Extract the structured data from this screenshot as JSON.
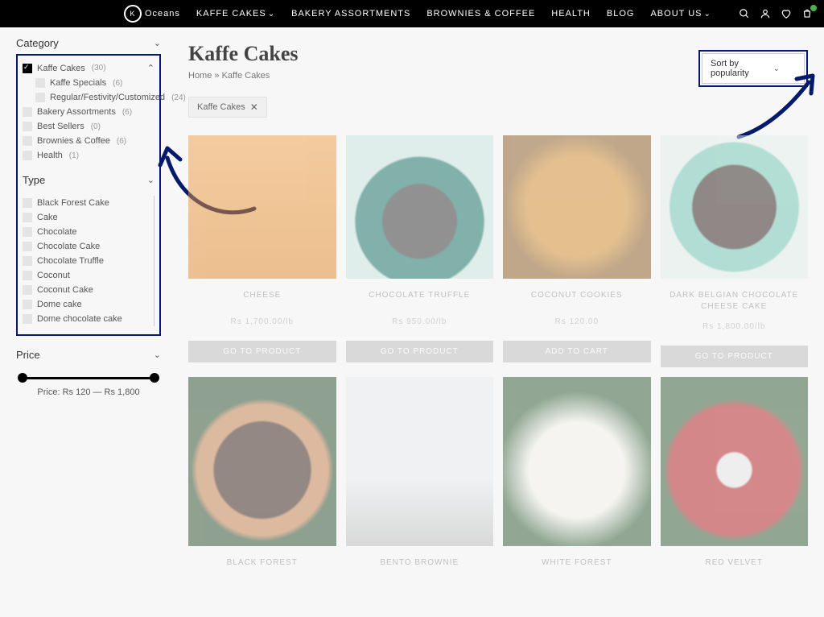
{
  "nav": {
    "brand": "Oceans",
    "items": [
      "KAFFE CAKES",
      "BAKERY ASSORTMENTS",
      "BROWNIES & COFFEE",
      "HEALTH",
      "BLOG",
      "ABOUT US"
    ]
  },
  "sidebar": {
    "category_heading": "Category",
    "type_heading": "Type",
    "price_heading": "Price",
    "categories": [
      {
        "label": "Kaffe Cakes",
        "count": "(30)",
        "checked": true
      },
      {
        "label": "Kaffe Specials",
        "count": "(6)",
        "checked": false,
        "indent": true
      },
      {
        "label": "Regular/Festivity/Customized",
        "count": "(24)",
        "checked": false,
        "indent": true
      },
      {
        "label": "Bakery Assortments",
        "count": "(6)",
        "checked": false
      },
      {
        "label": "Best Sellers",
        "count": "(0)",
        "checked": false
      },
      {
        "label": "Brownies & Coffee",
        "count": "(6)",
        "checked": false
      },
      {
        "label": "Health",
        "count": "(1)",
        "checked": false
      }
    ],
    "types": [
      "Black Forest Cake",
      "Cake",
      "Chocolate",
      "Chocolate Cake",
      "Chocolate Truffle",
      "Coconut",
      "Coconut Cake",
      "Dome cake",
      "Dome chocolate cake"
    ],
    "price_text": "Price: Rs 120 — Rs 1,800"
  },
  "header": {
    "title": "Kaffe Cakes",
    "breadcrumb_home": "Home",
    "breadcrumb_sep": " » ",
    "breadcrumb_current": "Kaffe Cakes",
    "filter_chip": "Kaffe Cakes",
    "sort_label": "Sort by popularity"
  },
  "products_row1": [
    {
      "title": "CHEESE",
      "price": "Rs 1,700.00/lb",
      "btn": "GO TO PRODUCT"
    },
    {
      "title": "CHOCOLATE TRUFFLE",
      "price": "Rs 950.00/lb",
      "btn": "GO TO PRODUCT"
    },
    {
      "title": "COCONUT COOKIES",
      "price": "Rs 120.00",
      "btn": "ADD TO CART"
    },
    {
      "title": "DARK BELGIAN CHOCOLATE CHEESE CAKE",
      "price": "Rs 1,800.00/lb",
      "btn": "GO TO PRODUCT"
    }
  ],
  "products_row2": [
    {
      "title": "BLACK FOREST"
    },
    {
      "title": "BENTO BROWNIE"
    },
    {
      "title": "WHITE FOREST"
    },
    {
      "title": "RED VELVET"
    }
  ]
}
